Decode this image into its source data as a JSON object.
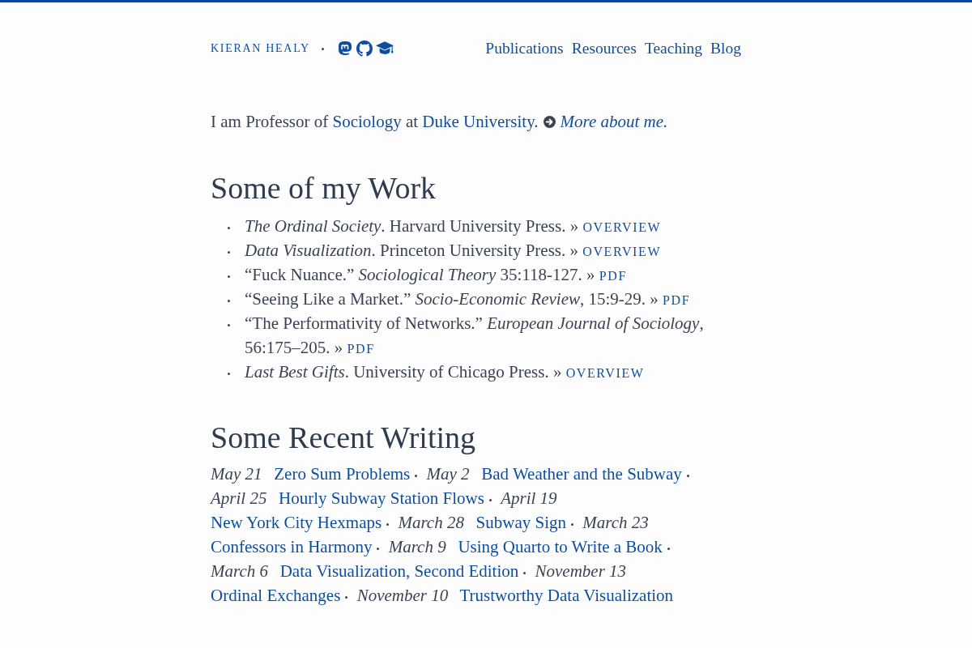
{
  "header": {
    "site_name": "KIERAN HEALY",
    "nav": [
      "Publications",
      "Resources",
      "Teaching",
      "Blog"
    ]
  },
  "intro": {
    "segments": [
      {
        "kind": "text",
        "text": "I am Professor of "
      },
      {
        "kind": "link",
        "text": "Sociology"
      },
      {
        "kind": "text",
        "text": " at "
      },
      {
        "kind": "link",
        "text": "Duke University"
      },
      {
        "kind": "text",
        "text": "."
      },
      {
        "kind": "more_link",
        "text": "More about me."
      }
    ]
  },
  "work": {
    "heading": "Some of my Work",
    "items": [
      {
        "text": "*The Ordinal Society*. Harvard University Press. »",
        "link": "OVERVIEW"
      },
      {
        "text": "*Data Visualization*. Princeton University Press. »",
        "link": "OVERVIEW"
      },
      {
        "text": "“Fuck Nuance.” *Sociological Theory* 35:118-127. »",
        "link": "PDF"
      },
      {
        "text": "“Seeing Like a Market.” *Socio-Economic Review*, 15:9-29. »",
        "link": "PDF"
      },
      {
        "text": "“The Performativity of Networks.” *European Journal of Sociology*, 56:175–205. »",
        "link": "PDF"
      },
      {
        "text": "*Last Best Gifts*. University of Chicago Press. »",
        "link": "OVERVIEW"
      }
    ]
  },
  "recent_writing": {
    "heading": "Some Recent Writing",
    "posts": [
      {
        "date": "May 21",
        "title": "Zero Sum Problems"
      },
      {
        "date": "May 2",
        "title": "Bad Weather and the Subway"
      },
      {
        "date": "April 25",
        "title": "Hourly Subway Station Flows"
      },
      {
        "date": "April 19",
        "title": "New York City Hexmaps"
      },
      {
        "date": "March 28",
        "title": "Subway Sign"
      },
      {
        "date": "March 23",
        "title": "Confessors in Harmony"
      },
      {
        "date": "March 9",
        "title": "Using Quarto to Write a Book"
      },
      {
        "date": "March 6",
        "title": "Data Visualization, Second Edition"
      },
      {
        "date": "November 13",
        "title": "Ordinal Exchanges"
      },
      {
        "date": "November 10",
        "title": "Trustworthy Data Visualization"
      }
    ]
  }
}
